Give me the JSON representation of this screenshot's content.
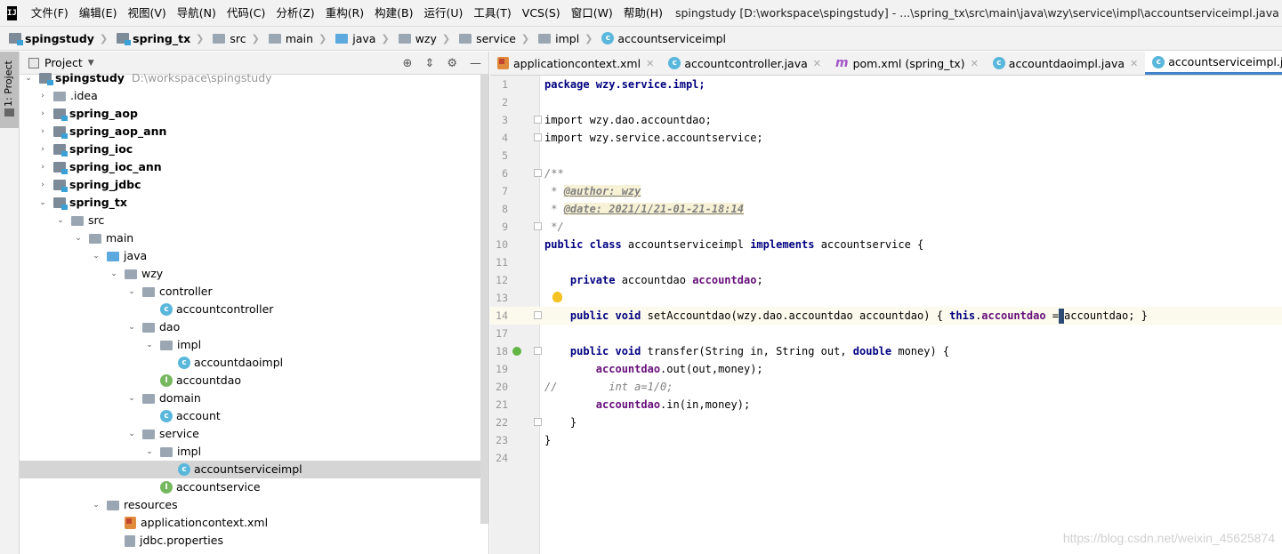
{
  "menubar": {
    "logo": "IJ",
    "items": [
      "文件(F)",
      "编辑(E)",
      "视图(V)",
      "导航(N)",
      "代码(C)",
      "分析(Z)",
      "重构(R)",
      "构建(B)",
      "运行(U)",
      "工具(T)",
      "VCS(S)",
      "窗口(W)",
      "帮助(H)"
    ],
    "title": "spingstudy [D:\\workspace\\spingstudy] - ...\\spring_tx\\src\\main\\java\\wzy\\service\\impl\\accountserviceimpl.java [spring_tx] - Int"
  },
  "breadcrumb": [
    "spingstudy",
    "spring_tx",
    "src",
    "main",
    "java",
    "wzy",
    "service",
    "impl",
    "accountserviceimpl"
  ],
  "sidebar_tab": "1: Project",
  "project": {
    "title": "Project",
    "root": "spingstudy",
    "root_path": "D:\\workspace\\spingstudy",
    "tree": [
      {
        "label": ".idea"
      },
      {
        "label": "spring_aop"
      },
      {
        "label": "spring_aop_ann"
      },
      {
        "label": "spring_ioc"
      },
      {
        "label": "spring_ioc_ann"
      },
      {
        "label": "spring_jdbc"
      },
      {
        "label": "spring_tx"
      },
      {
        "label": "src"
      },
      {
        "label": "main"
      },
      {
        "label": "java"
      },
      {
        "label": "wzy"
      },
      {
        "label": "controller"
      },
      {
        "label": "accountcontroller"
      },
      {
        "label": "dao"
      },
      {
        "label": "impl"
      },
      {
        "label": "accountdaoimpl"
      },
      {
        "label": "accountdao"
      },
      {
        "label": "domain"
      },
      {
        "label": "account"
      },
      {
        "label": "service"
      },
      {
        "label": "impl"
      },
      {
        "label": "accountserviceimpl"
      },
      {
        "label": "accountservice"
      },
      {
        "label": "resources"
      },
      {
        "label": "applicationcontext.xml"
      },
      {
        "label": "jdbc.properties"
      }
    ]
  },
  "tabs": [
    "applicationcontext.xml",
    "accountcontroller.java",
    "pom.xml (spring_tx)",
    "accountdaoimpl.java",
    "accountserviceimpl.java"
  ],
  "code": {
    "line_numbers": [
      "1",
      "2",
      "3",
      "4",
      "5",
      "6",
      "7",
      "8",
      "9",
      "10",
      "11",
      "12",
      "13",
      "14",
      "17",
      "18",
      "19",
      "20",
      "21",
      "22",
      "23",
      "24"
    ],
    "l1": "package wzy.service.impl;",
    "l3": "import wzy.dao.accountdao;",
    "l4": "import wzy.service.accountservice;",
    "l6": "/**",
    "l7a": " * ",
    "l7b": "@author: wzy",
    "l8a": " * ",
    "l8b": "@date: 2021/1/21-01-21-18:14",
    "l9": " */",
    "l10a": "public class ",
    "l10b": "accountserviceimpl ",
    "l10c": "implements ",
    "l10d": "accountservice {",
    "l12a": "    private ",
    "l12b": "accountdao ",
    "l12c": "accountdao",
    "l12d": ";",
    "l14a": "    public void ",
    "l14b": "setAccountdao(wzy.dao.accountdao accountdao) { ",
    "l14c": "this",
    "l14d": ".",
    "l14e": "accountdao",
    "l14f": " =",
    "l14g": "accountdao; }",
    "l18a": "    public void ",
    "l18b": "transfer(String in, String out, ",
    "l18c": "double ",
    "l18d": "money) {",
    "l19a": "        ",
    "l19b": "accountdao",
    "l19c": ".out(out,money);",
    "l20": "//        int a=1/0;",
    "l21a": "        ",
    "l21b": "accountdao",
    "l21c": ".in(in,money);",
    "l22": "    }",
    "l23": "}"
  },
  "watermark": "https://blog.csdn.net/weixin_45625874"
}
